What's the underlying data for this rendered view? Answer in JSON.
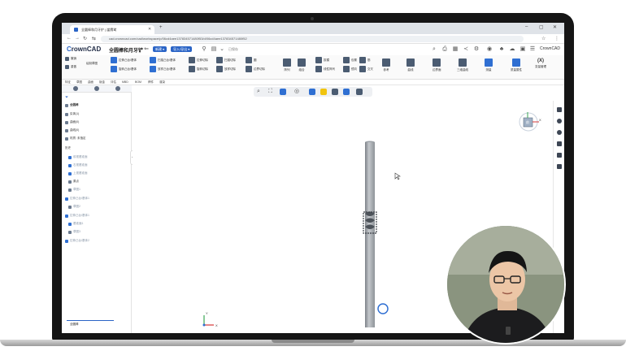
{
  "browser": {
    "tab_title": "全圆棒和月牙铲 | 崖鹰鹫",
    "new_tab": "+",
    "url": "cad.crowncad.com/cad/workspace/p/06cd4aee137834571480f53/d/06cd4aee137834571480f52",
    "window_controls": [
      "–",
      "▢",
      "✕"
    ]
  },
  "app": {
    "logo_prefix": "C",
    "logo_text": "rownCAD",
    "document_name": "全圆棒和月牙铲",
    "btn_new": "新建 ▾",
    "btn_import": "导入/导出 ▾",
    "saved": "已保存",
    "user": "CrownCAD"
  },
  "ribbon": {
    "undo": "撤销",
    "redo": "重做",
    "sketch": "绘制草图",
    "extrude_boss": "拉伸凸台/基体",
    "revolve_boss": "旋转凸台/基体",
    "sweep_boss": "扫描凸台/基体",
    "loft_boss": "放样凸台/基体",
    "extrude_cut": "拉伸切除",
    "revolve_cut": "旋转切除",
    "sweep_cut": "扫描切除",
    "loft_cut": "放样切除",
    "fillet": "圆",
    "boundary_cut": "边界切除",
    "pattern": "阵列",
    "line_pattern": "线性阵列",
    "mirror": "镜向",
    "rib": "筋",
    "wrap": "包覆",
    "draft": "拔模",
    "reference": "参考",
    "intersect": "交叉",
    "combine": "组合",
    "curves": "曲线",
    "boundary": "边界面",
    "3d_sketch": "三维曲线",
    "measure": "测量",
    "mass_props": "质量属性",
    "more": "(X)",
    "more_label": "变量管理"
  },
  "menu": [
    "特征",
    "草图",
    "曲面",
    "钣金",
    "评估",
    "MBD",
    "BOM",
    "焊件",
    "渲染"
  ],
  "tree": {
    "root": "全圆棒",
    "items": [
      "实体(1)",
      "曲面(0)",
      "曲线(0)",
      "材质: 未指定",
      "历史",
      "前视基准面",
      "右视基准面",
      "上视基准面",
      "原点",
      "草图1",
      "拉伸凸台/基体1",
      "草图2",
      "拉伸凸台/基体1",
      "基准面1",
      "草图3",
      "拉伸凸台/基体2"
    ],
    "bottom_tab": "全圆棒"
  },
  "viewport": {
    "x_axis": "X",
    "y_axis": "Y",
    "viewcube_face": "前",
    "viewcube_x": "X"
  },
  "colors": {
    "accent": "#2a64c6",
    "rod_light": "#c4c8cc",
    "rod_dark": "#7d8288"
  }
}
